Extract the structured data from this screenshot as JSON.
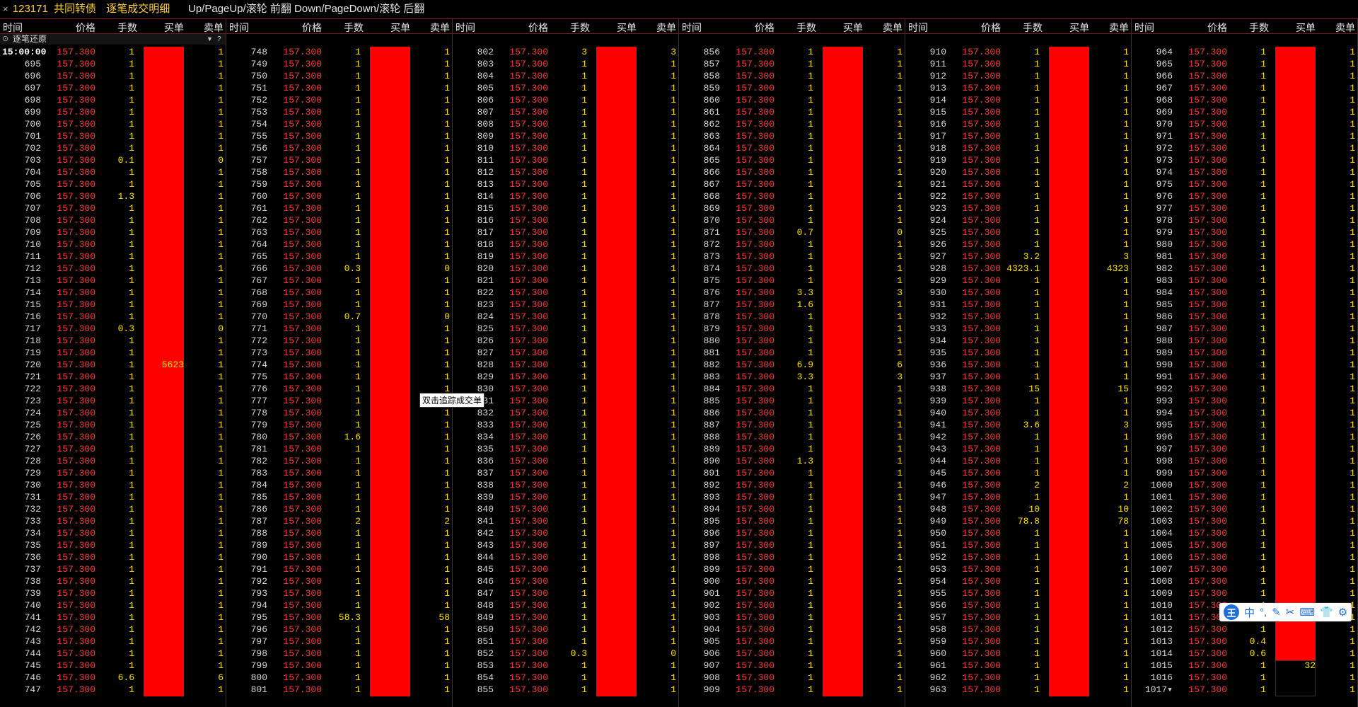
{
  "titlebar": {
    "close_icon": "×",
    "security_code": "123171",
    "security_name": "共同转债",
    "title": "逐笔成交明细",
    "hint": "Up/PageUp/滚轮 前翻 Down/PageDown/滚轮 后翻"
  },
  "headers": {
    "time": "时间",
    "price": "价格",
    "qty": "手数",
    "buy": "买单",
    "sell": "卖单"
  },
  "filter_label": "逐笔还原",
  "tooltip": "双击追踪成交单",
  "ime": {
    "logo": "王",
    "items": [
      "中",
      "°,",
      "✎",
      "✂",
      "⌨",
      "👕",
      "⚙"
    ]
  },
  "columns": [
    {
      "times": [
        "15:00:00",
        "695",
        "696",
        "697",
        "698",
        "699",
        "700",
        "701",
        "702",
        "703",
        "704",
        "705",
        "706",
        "707",
        "708",
        "709",
        "710",
        "711",
        "712",
        "713",
        "714",
        "715",
        "716",
        "717",
        "718",
        "719",
        "720",
        "721",
        "722",
        "723",
        "724",
        "725",
        "726",
        "727",
        "728",
        "729",
        "730",
        "731",
        "732",
        "733",
        "734",
        "735",
        "736",
        "737",
        "738",
        "739",
        "740",
        "741",
        "742",
        "743",
        "744",
        "745",
        "746",
        "747"
      ],
      "qty": [
        "1",
        "1",
        "1",
        "1",
        "1",
        "1",
        "1",
        "1",
        "1",
        "0.1",
        "1",
        "1",
        "1.3",
        "1",
        "1",
        "1",
        "1",
        "1",
        "1",
        "1",
        "1",
        "1",
        "1",
        "0.3",
        "1",
        "1",
        "1",
        "1",
        "1",
        "1",
        "1",
        "1",
        "1",
        "1",
        "1",
        "1",
        "1",
        "1",
        "1",
        "1",
        "1",
        "1",
        "1",
        "1",
        "1",
        "1",
        "1",
        "1",
        "1",
        "1",
        "1",
        "1",
        "6.6",
        "1"
      ],
      "sell": [
        "1",
        "1",
        "1",
        "1",
        "1",
        "1",
        "1",
        "1",
        "1",
        "0",
        "1",
        "1",
        "1",
        "1",
        "1",
        "1",
        "1",
        "1",
        "1",
        "1",
        "1",
        "1",
        "1",
        "0",
        "1",
        "1",
        "1",
        "1",
        "1",
        "1",
        "1",
        "1",
        "1",
        "1",
        "1",
        "1",
        "1",
        "1",
        "1",
        "1",
        "1",
        "1",
        "1",
        "1",
        "1",
        "1",
        "1",
        "1",
        "1",
        "1",
        "1",
        "1",
        "6",
        "1"
      ],
      "buy_label": {
        "row": 26,
        "value": "5623"
      }
    },
    {
      "times": [
        "748",
        "749",
        "750",
        "751",
        "752",
        "753",
        "754",
        "755",
        "756",
        "757",
        "758",
        "759",
        "760",
        "761",
        "762",
        "763",
        "764",
        "765",
        "766",
        "767",
        "768",
        "769",
        "770",
        "771",
        "772",
        "773",
        "774",
        "775",
        "776",
        "777",
        "778",
        "779",
        "780",
        "781",
        "782",
        "783",
        "784",
        "785",
        "786",
        "787",
        "788",
        "789",
        "790",
        "791",
        "792",
        "793",
        "794",
        "795",
        "796",
        "797",
        "798",
        "799",
        "800",
        "801"
      ],
      "qty": [
        "1",
        "1",
        "1",
        "1",
        "1",
        "1",
        "1",
        "1",
        "1",
        "1",
        "1",
        "1",
        "1",
        "1",
        "1",
        "1",
        "1",
        "1",
        "0.3",
        "1",
        "1",
        "1",
        "0.7",
        "1",
        "1",
        "1",
        "1",
        "1",
        "1",
        "1",
        "1",
        "1",
        "1.6",
        "1",
        "1",
        "1",
        "1",
        "1",
        "1",
        "2",
        "1",
        "1",
        "1",
        "1",
        "1",
        "1",
        "1",
        "58.3",
        "1",
        "1",
        "1",
        "1",
        "1",
        "1"
      ],
      "sell": [
        "1",
        "1",
        "1",
        "1",
        "1",
        "1",
        "1",
        "1",
        "1",
        "1",
        "1",
        "1",
        "1",
        "1",
        "1",
        "1",
        "1",
        "1",
        "0",
        "1",
        "1",
        "1",
        "0",
        "1",
        "1",
        "1",
        "1",
        "1",
        "1",
        "1",
        "1",
        "1",
        "1",
        "1",
        "1",
        "1",
        "1",
        "1",
        "1",
        "2",
        "1",
        "1",
        "1",
        "1",
        "1",
        "1",
        "1",
        "58",
        "1",
        "1",
        "1",
        "1",
        "1",
        "1"
      ]
    },
    {
      "times": [
        "802",
        "803",
        "804",
        "805",
        "806",
        "807",
        "808",
        "809",
        "810",
        "811",
        "812",
        "813",
        "814",
        "815",
        "816",
        "817",
        "818",
        "819",
        "820",
        "821",
        "822",
        "823",
        "824",
        "825",
        "826",
        "827",
        "828",
        "829",
        "830",
        "831",
        "832",
        "833",
        "834",
        "835",
        "836",
        "837",
        "838",
        "839",
        "840",
        "841",
        "842",
        "843",
        "844",
        "845",
        "846",
        "847",
        "848",
        "849",
        "850",
        "851",
        "852",
        "853",
        "854",
        "855"
      ],
      "qty": [
        "3",
        "1",
        "1",
        "1",
        "1",
        "1",
        "1",
        "1",
        "1",
        "1",
        "1",
        "1",
        "1",
        "1",
        "1",
        "1",
        "1",
        "1",
        "1",
        "1",
        "1",
        "1",
        "1",
        "1",
        "1",
        "1",
        "1",
        "1",
        "1",
        "1",
        "1",
        "1",
        "1",
        "1",
        "1",
        "1",
        "1",
        "1",
        "1",
        "1",
        "1",
        "1",
        "1",
        "1",
        "1",
        "1",
        "1",
        "1",
        "1",
        "1",
        "0.3",
        "1",
        "1",
        "1"
      ],
      "sell": [
        "3",
        "1",
        "1",
        "1",
        "1",
        "1",
        "1",
        "1",
        "1",
        "1",
        "1",
        "1",
        "1",
        "1",
        "1",
        "1",
        "1",
        "1",
        "1",
        "1",
        "1",
        "1",
        "1",
        "1",
        "1",
        "1",
        "1",
        "1",
        "1",
        "1",
        "1",
        "1",
        "1",
        "1",
        "1",
        "1",
        "1",
        "1",
        "1",
        "1",
        "1",
        "1",
        "1",
        "1",
        "1",
        "1",
        "1",
        "1",
        "1",
        "1",
        "0",
        "1",
        "1",
        "1"
      ]
    },
    {
      "times": [
        "856",
        "857",
        "858",
        "859",
        "860",
        "861",
        "862",
        "863",
        "864",
        "865",
        "866",
        "867",
        "868",
        "869",
        "870",
        "871",
        "872",
        "873",
        "874",
        "875",
        "876",
        "877",
        "878",
        "879",
        "880",
        "881",
        "882",
        "883",
        "884",
        "885",
        "886",
        "887",
        "888",
        "889",
        "890",
        "891",
        "892",
        "893",
        "894",
        "895",
        "896",
        "897",
        "898",
        "899",
        "900",
        "901",
        "902",
        "903",
        "904",
        "905",
        "906",
        "907",
        "908",
        "909"
      ],
      "qty": [
        "1",
        "1",
        "1",
        "1",
        "1",
        "1",
        "1",
        "1",
        "1",
        "1",
        "1",
        "1",
        "1",
        "1",
        "1",
        "0.7",
        "1",
        "1",
        "1",
        "1",
        "3.3",
        "1.6",
        "1",
        "1",
        "1",
        "1",
        "6.9",
        "3.3",
        "1",
        "1",
        "1",
        "1",
        "1",
        "1",
        "1.3",
        "1",
        "1",
        "1",
        "1",
        "1",
        "1",
        "1",
        "1",
        "1",
        "1",
        "1",
        "1",
        "1",
        "1",
        "1",
        "1",
        "1",
        "1",
        "1"
      ],
      "sell": [
        "1",
        "1",
        "1",
        "1",
        "1",
        "1",
        "1",
        "1",
        "1",
        "1",
        "1",
        "1",
        "1",
        "1",
        "1",
        "0",
        "1",
        "1",
        "1",
        "1",
        "3",
        "1",
        "1",
        "1",
        "1",
        "1",
        "6",
        "3",
        "1",
        "1",
        "1",
        "1",
        "1",
        "1",
        "1",
        "1",
        "1",
        "1",
        "1",
        "1",
        "1",
        "1",
        "1",
        "1",
        "1",
        "1",
        "1",
        "1",
        "1",
        "1",
        "1",
        "1",
        "1",
        "1"
      ]
    },
    {
      "times": [
        "910",
        "911",
        "912",
        "913",
        "914",
        "915",
        "916",
        "917",
        "918",
        "919",
        "920",
        "921",
        "922",
        "923",
        "924",
        "925",
        "926",
        "927",
        "928",
        "929",
        "930",
        "931",
        "932",
        "933",
        "934",
        "935",
        "936",
        "937",
        "938",
        "939",
        "940",
        "941",
        "942",
        "943",
        "944",
        "945",
        "946",
        "947",
        "948",
        "949",
        "950",
        "951",
        "952",
        "953",
        "954",
        "955",
        "956",
        "957",
        "958",
        "959",
        "960",
        "961",
        "962",
        "963"
      ],
      "qty": [
        "1",
        "1",
        "1",
        "1",
        "1",
        "1",
        "1",
        "1",
        "1",
        "1",
        "1",
        "1",
        "1",
        "1",
        "1",
        "1",
        "1",
        "3.2",
        "4323.1",
        "1",
        "1",
        "1",
        "1",
        "1",
        "1",
        "1",
        "1",
        "1",
        "15",
        "1",
        "1",
        "3.6",
        "1",
        "1",
        "1",
        "1",
        "2",
        "1",
        "10",
        "78.8",
        "1",
        "1",
        "1",
        "1",
        "1",
        "1",
        "1",
        "1",
        "1",
        "1",
        "1",
        "1",
        "1",
        "1"
      ],
      "sell": [
        "1",
        "1",
        "1",
        "1",
        "1",
        "1",
        "1",
        "1",
        "1",
        "1",
        "1",
        "1",
        "1",
        "1",
        "1",
        "1",
        "1",
        "3",
        "4323",
        "1",
        "1",
        "1",
        "1",
        "1",
        "1",
        "1",
        "1",
        "1",
        "15",
        "1",
        "1",
        "3",
        "1",
        "1",
        "1",
        "1",
        "2",
        "1",
        "10",
        "78",
        "1",
        "1",
        "1",
        "1",
        "1",
        "1",
        "1",
        "1",
        "1",
        "1",
        "1",
        "1",
        "1",
        "1"
      ]
    },
    {
      "times": [
        "964",
        "965",
        "966",
        "967",
        "968",
        "969",
        "970",
        "971",
        "972",
        "973",
        "974",
        "975",
        "976",
        "977",
        "978",
        "979",
        "980",
        "981",
        "982",
        "983",
        "984",
        "985",
        "986",
        "987",
        "988",
        "989",
        "990",
        "991",
        "992",
        "993",
        "994",
        "995",
        "996",
        "997",
        "998",
        "999",
        "1000",
        "1001",
        "1002",
        "1003",
        "1004",
        "1005",
        "1006",
        "1007",
        "1008",
        "1009",
        "1010",
        "1011",
        "1012",
        "1013",
        "1014",
        "1015",
        "1016",
        "1017▾"
      ],
      "qty": [
        "1",
        "1",
        "1",
        "1",
        "1",
        "1",
        "1",
        "1",
        "1",
        "1",
        "1",
        "1",
        "1",
        "1",
        "1",
        "1",
        "1",
        "1",
        "1",
        "1",
        "1",
        "1",
        "1",
        "1",
        "1",
        "1",
        "1",
        "1",
        "1",
        "1",
        "1",
        "1",
        "1",
        "1",
        "1",
        "1",
        "1",
        "1",
        "1",
        "1",
        "1",
        "1",
        "1",
        "1",
        "1",
        "1",
        "1",
        "1",
        "1",
        "0.4",
        "0.6",
        "1",
        "1",
        "1"
      ],
      "sell": [
        "1",
        "1",
        "1",
        "1",
        "1",
        "1",
        "1",
        "1",
        "1",
        "1",
        "1",
        "1",
        "1",
        "1",
        "1",
        "1",
        "1",
        "1",
        "1",
        "1",
        "1",
        "1",
        "1",
        "1",
        "1",
        "1",
        "1",
        "1",
        "1",
        "1",
        "1",
        "1",
        "1",
        "1",
        "1",
        "1",
        "1",
        "1",
        "1",
        "1",
        "1",
        "1",
        "1",
        "1",
        "1",
        "1",
        "1",
        "1",
        "1",
        "1",
        "1",
        "1",
        "1",
        "1"
      ],
      "buy_label": {
        "row": 51,
        "value": "32"
      }
    }
  ],
  "price": "157.300"
}
